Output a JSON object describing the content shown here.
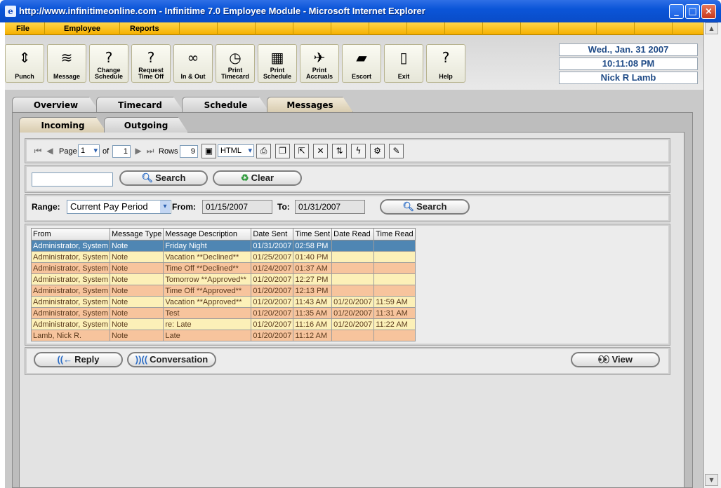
{
  "window": {
    "title": "http://www.infinitimeonline.com - Infinitime 7.0 Employee Module - Microsoft Internet Explorer"
  },
  "menu": [
    "File",
    "Employee",
    "Reports"
  ],
  "toolbar": [
    {
      "label": "Punch",
      "icon": "punch-icon",
      "glyph": "⇕"
    },
    {
      "label": "Message",
      "icon": "wireless-icon",
      "glyph": "≋"
    },
    {
      "label": "Change Schedule",
      "icon": "question-clock-icon",
      "glyph": "?"
    },
    {
      "label": "Request Time Off",
      "icon": "question-clock-icon",
      "glyph": "?"
    },
    {
      "label": "In & Out",
      "icon": "binoculars-icon",
      "glyph": "∞"
    },
    {
      "label": "Print Timecard",
      "icon": "clock-icon",
      "glyph": "◷"
    },
    {
      "label": "Print Schedule",
      "icon": "calendar-icon",
      "glyph": "▦"
    },
    {
      "label": "Print Accruals",
      "icon": "airplane-icon",
      "glyph": "✈"
    },
    {
      "label": "Escort",
      "icon": "taxi-icon",
      "glyph": "▰"
    },
    {
      "label": "Exit",
      "icon": "door-icon",
      "glyph": "▯"
    },
    {
      "label": "Help",
      "icon": "question-icon",
      "glyph": "?"
    }
  ],
  "info": {
    "date": "Wed., Jan. 31 2007",
    "time": "10:11:08 PM",
    "user": "Nick R Lamb"
  },
  "tabs": [
    "Overview",
    "Timecard",
    "Schedule",
    "Messages"
  ],
  "subtabs": [
    "Incoming",
    "Outgoing"
  ],
  "pager": {
    "page_label": "Page",
    "page": "1",
    "of_label": "of",
    "total": "1",
    "rows_label": "Rows",
    "rows": "9",
    "format": "HTML"
  },
  "search": {
    "value": "",
    "search_label": "Search",
    "clear_label": "Clear"
  },
  "range": {
    "label": "Range:",
    "value": "Current Pay Period",
    "from_label": "From:",
    "from": "01/15/2007",
    "to_label": "To:",
    "to": "01/31/2007",
    "search_label": "Search"
  },
  "table": {
    "columns": [
      "From",
      "Message Type",
      "Message Description",
      "Date Sent",
      "Time Sent",
      "Date Read",
      "Time Read"
    ],
    "rows": [
      [
        "Administrator, System",
        "Note",
        "Friday Night",
        "01/31/2007",
        "02:58 PM",
        "",
        ""
      ],
      [
        "Administrator, System",
        "Note",
        "Vacation **Declined**",
        "01/25/2007",
        "01:40 PM",
        "",
        ""
      ],
      [
        "Administrator, System",
        "Note",
        "Time Off **Declined**",
        "01/24/2007",
        "01:37 AM",
        "",
        ""
      ],
      [
        "Administrator, System",
        "Note",
        "Tomorrow **Approved**",
        "01/20/2007",
        "12:27 PM",
        "",
        ""
      ],
      [
        "Administrator, System",
        "Note",
        "Time Off **Approved**",
        "01/20/2007",
        "12:13 PM",
        "",
        ""
      ],
      [
        "Administrator, System",
        "Note",
        "Vacation **Approved**",
        "01/20/2007",
        "11:43 AM",
        "01/20/2007",
        "11:59 AM"
      ],
      [
        "Administrator, System",
        "Note",
        "Test",
        "01/20/2007",
        "11:35 AM",
        "01/20/2007",
        "11:31 AM"
      ],
      [
        "Administrator, System",
        "Note",
        "re: Late",
        "01/20/2007",
        "11:16 AM",
        "01/20/2007",
        "11:22 AM"
      ],
      [
        "Lamb, Nick R.",
        "Note",
        "Late",
        "01/20/2007",
        "11:12 AM",
        "",
        ""
      ]
    ]
  },
  "actions": {
    "reply": "Reply",
    "conversation": "Conversation",
    "view": "View"
  }
}
